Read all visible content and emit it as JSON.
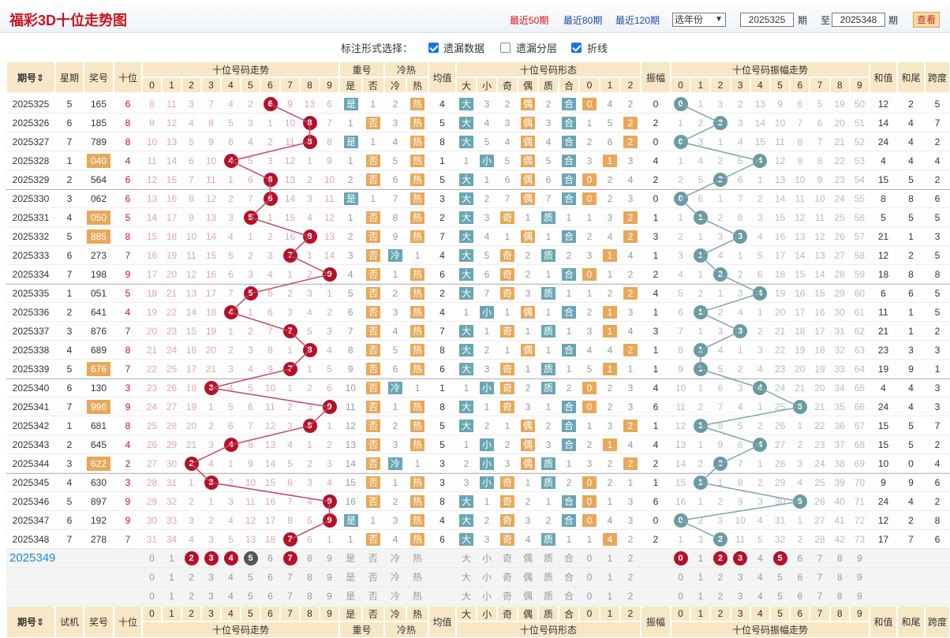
{
  "header": {
    "title": "福彩3D十位走势图",
    "links": [
      "最近50期",
      "最近80期",
      "最近120期"
    ],
    "year_select": "选年份",
    "from_issue": "2025325",
    "period_label1": "期",
    "to_label": "至",
    "to_issue": "2025348",
    "period_label2": "期",
    "query_button": "查看"
  },
  "options": {
    "label": "标注形式选择：",
    "items": [
      {
        "label": "遗漏数据",
        "checked": true
      },
      {
        "label": "遗漏分层",
        "checked": false
      },
      {
        "label": "折线",
        "checked": true
      }
    ]
  },
  "columns": {
    "issue": "期号",
    "week": "星期",
    "prize": "奖号",
    "tens": "十位",
    "trend": "十位号码走势",
    "repeat": "重号",
    "repeat_sub": [
      "是",
      "否"
    ],
    "hotcold": "冷热",
    "hotcold_sub": [
      "冷",
      "热"
    ],
    "avg": "均值",
    "form": "十位号码形态",
    "form_sub": [
      "大",
      "小",
      "奇",
      "偶",
      "质",
      "合",
      "0",
      "1",
      "2"
    ],
    "amp": "振幅",
    "amp_trend": "十位号码振幅走势",
    "sum": "和值",
    "tail": "和尾",
    "span": "跨度",
    "digits": [
      "0",
      "1",
      "2",
      "3",
      "4",
      "5",
      "6",
      "7",
      "8",
      "9"
    ],
    "footer_week": "试机"
  },
  "rows": [
    {
      "issue": "2025325",
      "week": "5",
      "prize": "165",
      "tens": 6,
      "miss": [
        8,
        11,
        3,
        7,
        4,
        2,
        null,
        9,
        13,
        6
      ],
      "rep": "是",
      "rep2": "1",
      "hc1": "2",
      "hc2": "热",
      "avg": "4",
      "form": [
        "大",
        "3",
        "2",
        "偶",
        "2",
        "合",
        "0",
        "4",
        "2"
      ],
      "amp": "0",
      "ampmiss": [
        null,
        1,
        3,
        2,
        13,
        9,
        6,
        5,
        19,
        50
      ],
      "sum": "12",
      "tail": "2",
      "span": "5"
    },
    {
      "issue": "2025326",
      "week": "6",
      "prize": "185",
      "tens": 8,
      "miss": [
        9,
        12,
        4,
        8,
        5,
        3,
        1,
        10,
        null,
        7
      ],
      "rep": "1",
      "rep2": "否",
      "hc1": "3",
      "hc2": "热",
      "avg": "5",
      "form": [
        "大",
        "4",
        "3",
        "偶",
        "3",
        "合",
        "1",
        "5",
        "2"
      ],
      "amp": "2",
      "ampmiss": [
        1,
        2,
        null,
        3,
        14,
        10,
        7,
        6,
        20,
        51
      ],
      "sum": "14",
      "tail": "4",
      "span": "7"
    },
    {
      "issue": "2025327",
      "week": "7",
      "prize": "789",
      "tens": 8,
      "miss": [
        10,
        13,
        5,
        9,
        6,
        4,
        2,
        11,
        null,
        8
      ],
      "rep": "是",
      "rep2": "1",
      "hc1": "4",
      "hc2": "热",
      "avg": "8",
      "form": [
        "大",
        "5",
        "4",
        "偶",
        "4",
        "合",
        "2",
        "6",
        "2"
      ],
      "amp": "0",
      "ampmiss": [
        null,
        3,
        1,
        4,
        15,
        11,
        8,
        7,
        21,
        52
      ],
      "sum": "24",
      "tail": "4",
      "span": "2"
    },
    {
      "issue": "2025328",
      "week": "1",
      "prize": "040",
      "tens": 4,
      "miss": [
        11,
        14,
        6,
        10,
        null,
        5,
        3,
        12,
        1,
        9
      ],
      "rep": "1",
      "rep2": "否",
      "hc1": "5",
      "hc2": "热",
      "avg": "1",
      "form": [
        "1",
        "小",
        "5",
        "偶",
        "5",
        "合",
        "3",
        "1",
        "3"
      ],
      "amp": "4",
      "ampmiss": [
        1,
        4,
        2,
        5,
        null,
        12,
        9,
        8,
        22,
        53
      ],
      "sum": "4",
      "tail": "4",
      "span": "4"
    },
    {
      "issue": "2025329",
      "week": "2",
      "prize": "564",
      "tens": 6,
      "miss": [
        12,
        15,
        7,
        11,
        1,
        6,
        null,
        13,
        2,
        10
      ],
      "rep": "2",
      "rep2": "否",
      "hc1": "6",
      "hc2": "热",
      "avg": "5",
      "form": [
        "大",
        "1",
        "6",
        "偶",
        "6",
        "合",
        "0",
        "2",
        "4"
      ],
      "amp": "2",
      "ampmiss": [
        2,
        5,
        null,
        6,
        1,
        13,
        10,
        9,
        23,
        54
      ],
      "sum": "15",
      "tail": "5",
      "span": "2"
    },
    {
      "issue": "2025330",
      "week": "3",
      "prize": "062",
      "tens": 6,
      "miss": [
        13,
        16,
        8,
        12,
        2,
        7,
        null,
        14,
        3,
        11
      ],
      "rep": "是",
      "rep2": "1",
      "hc1": "7",
      "hc2": "热",
      "avg": "3",
      "form": [
        "大",
        "2",
        "7",
        "偶",
        "7",
        "合",
        "0",
        "2",
        "3"
      ],
      "amp": "0",
      "ampmiss": [
        null,
        6,
        1,
        7,
        2,
        14,
        11,
        10,
        24,
        55
      ],
      "sum": "8",
      "tail": "8",
      "span": "6"
    },
    {
      "issue": "2025331",
      "week": "4",
      "prize": "050",
      "tens": 5,
      "miss": [
        14,
        17,
        9,
        13,
        3,
        null,
        1,
        15,
        4,
        12
      ],
      "rep": "1",
      "rep2": "否",
      "hc1": "8",
      "hc2": "热",
      "avg": "2",
      "form": [
        "大",
        "3",
        "奇",
        "1",
        "质",
        "1",
        "1",
        "3",
        "2"
      ],
      "amp": "1",
      "ampmiss": [
        1,
        null,
        2,
        8,
        3,
        15,
        12,
        11,
        25,
        56
      ],
      "sum": "5",
      "tail": "5",
      "span": "5"
    },
    {
      "issue": "2025332",
      "week": "5",
      "prize": "885",
      "tens": 8,
      "miss": [
        15,
        18,
        10,
        14,
        4,
        1,
        2,
        16,
        null,
        13
      ],
      "rep": "2",
      "rep2": "否",
      "hc1": "9",
      "hc2": "热",
      "avg": "7",
      "form": [
        "大",
        "4",
        "1",
        "偶",
        "1",
        "合",
        "2",
        "4",
        "2"
      ],
      "amp": "3",
      "ampmiss": [
        2,
        1,
        3,
        null,
        4,
        16,
        13,
        12,
        26,
        57
      ],
      "sum": "21",
      "tail": "1",
      "span": "3"
    },
    {
      "issue": "2025333",
      "week": "6",
      "prize": "273",
      "tens": 7,
      "miss": [
        16,
        19,
        11,
        15,
        5,
        2,
        3,
        null,
        1,
        14
      ],
      "rep": "3",
      "rep2": "否",
      "hc1": "冷",
      "hc2": "1",
      "avg": "4",
      "form": [
        "大",
        "5",
        "奇",
        "2",
        "质",
        "2",
        "3",
        "1",
        "4"
      ],
      "amp": "1",
      "ampmiss": [
        3,
        null,
        4,
        1,
        5,
        17,
        14,
        13,
        27,
        58
      ],
      "sum": "12",
      "tail": "2",
      "span": "5"
    },
    {
      "issue": "2025334",
      "week": "7",
      "prize": "198",
      "tens": 9,
      "miss": [
        17,
        20,
        12,
        16,
        6,
        3,
        4,
        1,
        2,
        null
      ],
      "rep": "4",
      "rep2": "否",
      "hc1": "1",
      "hc2": "热",
      "avg": "6",
      "form": [
        "大",
        "6",
        "奇",
        "2",
        "1",
        "合",
        "0",
        "1",
        "2"
      ],
      "amp": "2",
      "ampmiss": [
        4,
        1,
        null,
        2,
        6,
        18,
        15,
        14,
        28,
        59
      ],
      "sum": "18",
      "tail": "8",
      "span": "8"
    },
    {
      "issue": "2025335",
      "week": "1",
      "prize": "051",
      "tens": 5,
      "miss": [
        18,
        21,
        13,
        17,
        7,
        null,
        5,
        2,
        3,
        1
      ],
      "rep": "5",
      "rep2": "否",
      "hc1": "2",
      "hc2": "热",
      "avg": "2",
      "form": [
        "大",
        "7",
        "奇",
        "3",
        "质",
        "1",
        "1",
        "2",
        "2"
      ],
      "amp": "4",
      "ampmiss": [
        5,
        2,
        1,
        3,
        null,
        19,
        16,
        15,
        29,
        60
      ],
      "sum": "6",
      "tail": "6",
      "span": "5"
    },
    {
      "issue": "2025336",
      "week": "2",
      "prize": "641",
      "tens": 4,
      "miss": [
        19,
        22,
        14,
        18,
        null,
        1,
        6,
        3,
        4,
        2
      ],
      "rep": "6",
      "rep2": "否",
      "hc1": "3",
      "hc2": "热",
      "avg": "4",
      "form": [
        "1",
        "小",
        "1",
        "偶",
        "1",
        "合",
        "2",
        "1",
        "3"
      ],
      "amp": "1",
      "ampmiss": [
        6,
        null,
        2,
        4,
        1,
        20,
        17,
        16,
        30,
        61
      ],
      "sum": "11",
      "tail": "1",
      "span": "5"
    },
    {
      "issue": "2025337",
      "week": "3",
      "prize": "876",
      "tens": 7,
      "miss": [
        20,
        23,
        15,
        19,
        1,
        2,
        7,
        null,
        5,
        3
      ],
      "rep": "7",
      "rep2": "否",
      "hc1": "4",
      "hc2": "热",
      "avg": "7",
      "form": [
        "大",
        "1",
        "奇",
        "1",
        "质",
        "1",
        "3",
        "1",
        "4"
      ],
      "amp": "3",
      "ampmiss": [
        7,
        1,
        3,
        null,
        2,
        21,
        18,
        17,
        31,
        62
      ],
      "sum": "21",
      "tail": "1",
      "span": "2"
    },
    {
      "issue": "2025338",
      "week": "4",
      "prize": "689",
      "tens": 8,
      "miss": [
        21,
        24,
        16,
        20,
        2,
        3,
        8,
        1,
        null,
        4
      ],
      "rep": "8",
      "rep2": "否",
      "hc1": "5",
      "hc2": "热",
      "avg": "8",
      "form": [
        "大",
        "2",
        "1",
        "偶",
        "1",
        "合",
        "4",
        "4",
        "2"
      ],
      "amp": "1",
      "ampmiss": [
        8,
        null,
        4,
        1,
        3,
        22,
        19,
        18,
        32,
        63
      ],
      "sum": "23",
      "tail": "3",
      "span": "3"
    },
    {
      "issue": "2025339",
      "week": "5",
      "prize": "676",
      "tens": 7,
      "miss": [
        22,
        25,
        17,
        21,
        3,
        4,
        9,
        null,
        1,
        5
      ],
      "rep": "9",
      "rep2": "否",
      "hc1": "6",
      "hc2": "热",
      "avg": "6",
      "form": [
        "大",
        "3",
        "奇",
        "1",
        "质",
        "1",
        "5",
        "1",
        "1"
      ],
      "amp": "1",
      "ampmiss": [
        9,
        null,
        5,
        2,
        4,
        23,
        20,
        19,
        33,
        64
      ],
      "sum": "19",
      "tail": "9",
      "span": "1"
    },
    {
      "issue": "2025340",
      "week": "6",
      "prize": "130",
      "tens": 3,
      "miss": [
        23,
        26,
        18,
        null,
        4,
        5,
        10,
        1,
        2,
        6
      ],
      "rep": "10",
      "rep2": "否",
      "hc1": "冷",
      "hc2": "1",
      "avg": "1",
      "form": [
        "1",
        "小",
        "奇",
        "2",
        "质",
        "2",
        "0",
        "2",
        "3"
      ],
      "amp": "4",
      "ampmiss": [
        10,
        1,
        6,
        3,
        null,
        24,
        21,
        20,
        34,
        65
      ],
      "sum": "4",
      "tail": "4",
      "span": "3"
    },
    {
      "issue": "2025341",
      "week": "7",
      "prize": "996",
      "tens": 9,
      "miss": [
        24,
        27,
        19,
        1,
        5,
        6,
        11,
        2,
        3,
        null
      ],
      "rep": "11",
      "rep2": "否",
      "hc1": "1",
      "hc2": "热",
      "avg": "8",
      "form": [
        "大",
        "1",
        "奇",
        "3",
        "1",
        "合",
        "0",
        "2",
        "3"
      ],
      "amp": "6",
      "ampmiss": [
        11,
        2,
        7,
        4,
        1,
        25,
        null,
        21,
        35,
        66
      ],
      "sum": "24",
      "tail": "4",
      "span": "3"
    },
    {
      "issue": "2025342",
      "week": "1",
      "prize": "681",
      "tens": 8,
      "miss": [
        25,
        28,
        20,
        2,
        6,
        7,
        12,
        3,
        null,
        1
      ],
      "rep": "12",
      "rep2": "否",
      "hc1": "2",
      "hc2": "热",
      "avg": "5",
      "form": [
        "大",
        "2",
        "1",
        "偶",
        "2",
        "合",
        "1",
        "3",
        "2"
      ],
      "amp": "1",
      "ampmiss": [
        12,
        null,
        8,
        5,
        2,
        26,
        1,
        22,
        36,
        67
      ],
      "sum": "15",
      "tail": "5",
      "span": "7"
    },
    {
      "issue": "2025343",
      "week": "2",
      "prize": "645",
      "tens": 4,
      "miss": [
        26,
        29,
        21,
        3,
        null,
        8,
        13,
        4,
        1,
        2
      ],
      "rep": "13",
      "rep2": "否",
      "hc1": "3",
      "hc2": "热",
      "avg": "5",
      "form": [
        "1",
        "小",
        "2",
        "偶",
        "3",
        "合",
        "2",
        "1",
        "4"
      ],
      "amp": "4",
      "ampmiss": [
        13,
        1,
        9,
        6,
        null,
        27,
        2,
        23,
        37,
        68
      ],
      "sum": "15",
      "tail": "5",
      "span": "2"
    },
    {
      "issue": "2025344",
      "week": "3",
      "prize": "622",
      "tens": 2,
      "miss": [
        27,
        30,
        null,
        4,
        1,
        9,
        14,
        5,
        2,
        3
      ],
      "rep": "14",
      "rep2": "否",
      "hc1": "冷",
      "hc2": "1",
      "avg": "3",
      "form": [
        "2",
        "小",
        "3",
        "偶",
        "质",
        "1",
        "3",
        "2",
        "2"
      ],
      "amp": "2",
      "ampmiss": [
        14,
        2,
        null,
        7,
        1,
        28,
        3,
        24,
        38,
        69
      ],
      "sum": "10",
      "tail": "0",
      "span": "4"
    },
    {
      "issue": "2025345",
      "week": "4",
      "prize": "630",
      "tens": 3,
      "miss": [
        28,
        31,
        1,
        null,
        2,
        10,
        15,
        6,
        3,
        4
      ],
      "rep": "15",
      "rep2": "否",
      "hc1": "1",
      "hc2": "热",
      "avg": "3",
      "form": [
        "3",
        "小",
        "奇",
        "1",
        "质",
        "2",
        "0",
        "2",
        "1"
      ],
      "amp": "1",
      "ampmiss": [
        15,
        null,
        1,
        8,
        2,
        29,
        4,
        25,
        39,
        70
      ],
      "sum": "9",
      "tail": "9",
      "span": "6"
    },
    {
      "issue": "2025346",
      "week": "5",
      "prize": "897",
      "tens": 9,
      "miss": [
        29,
        32,
        2,
        1,
        3,
        11,
        16,
        7,
        4,
        null
      ],
      "rep": "16",
      "rep2": "否",
      "hc1": "2",
      "hc2": "热",
      "avg": "8",
      "form": [
        "大",
        "1",
        "奇",
        "2",
        "1",
        "合",
        "0",
        "1",
        "3"
      ],
      "amp": "6",
      "ampmiss": [
        16,
        1,
        2,
        9,
        3,
        30,
        null,
        26,
        40,
        71
      ],
      "sum": "24",
      "tail": "4",
      "span": "2"
    },
    {
      "issue": "2025347",
      "week": "6",
      "prize": "192",
      "tens": 9,
      "miss": [
        30,
        33,
        3,
        2,
        4,
        12,
        17,
        8,
        5,
        null
      ],
      "rep": "是",
      "rep2": "1",
      "hc1": "3",
      "hc2": "热",
      "avg": "4",
      "form": [
        "大",
        "2",
        "奇",
        "3",
        "2",
        "合",
        "0",
        "4",
        "3"
      ],
      "amp": "0",
      "ampmiss": [
        null,
        2,
        3,
        10,
        4,
        31,
        1,
        27,
        41,
        72
      ],
      "sum": "12",
      "tail": "2",
      "span": "8"
    },
    {
      "issue": "2025348",
      "week": "7",
      "prize": "278",
      "tens": 7,
      "miss": [
        31,
        34,
        4,
        3,
        5,
        13,
        18,
        null,
        6,
        1
      ],
      "rep": "1",
      "rep2": "否",
      "hc1": "4",
      "hc2": "热",
      "avg": "6",
      "form": [
        "大",
        "3",
        "奇",
        "4",
        "质",
        "1",
        "1",
        "4",
        "2"
      ],
      "amp": "2",
      "ampmiss": [
        1,
        3,
        null,
        11,
        5,
        32,
        2,
        28,
        42,
        73
      ],
      "sum": "17",
      "tail": "7",
      "span": "6"
    }
  ],
  "forecast": {
    "issue": "2025349",
    "trend_marked": [
      "2",
      "3",
      "4",
      "5",
      "7"
    ],
    "amp_marked": [
      "0",
      "2",
      "3",
      "5"
    ]
  },
  "footer": {
    "issue": "期号",
    "week": "试机",
    "prize": "奖号",
    "tens": "十位",
    "trend": "十位号码走势",
    "repeat": "重号",
    "hotcold": "冷热",
    "avg": "均值",
    "form": "十位号码形态",
    "amp": "振幅",
    "amp_trend": "十位号码振幅走势",
    "sum": "和值",
    "tail": "和尾",
    "span": "跨度"
  },
  "colors": {
    "ball_red": "#b5112b",
    "ball_teal": "#6a9ba3",
    "header_bg": "#f7e7c6",
    "tag_orange": "#e7a85a",
    "tag_teal": "#6aa6b3"
  }
}
